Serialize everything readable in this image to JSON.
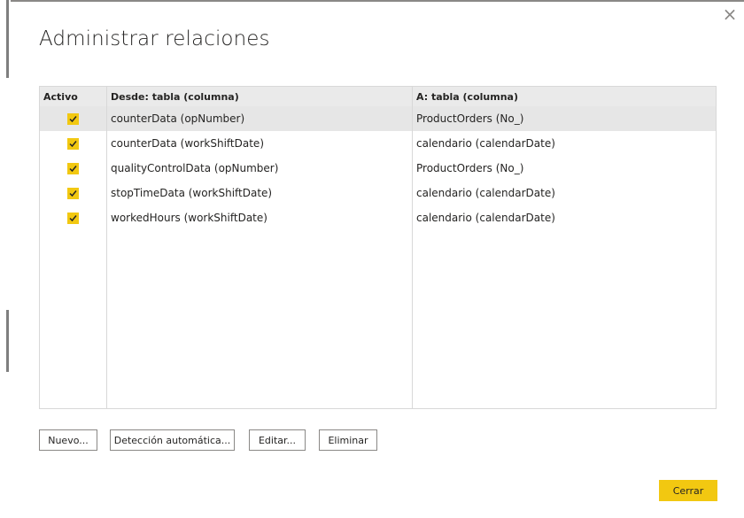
{
  "dialog": {
    "title": "Administrar relaciones",
    "close_glyph": "×"
  },
  "table": {
    "headers": {
      "active": "Activo",
      "from": "Desde: tabla (columna)",
      "to": "A: tabla (columna)"
    },
    "rows": [
      {
        "active": true,
        "from": "counterData (opNumber)",
        "to": "ProductOrders (No_)",
        "selected": true
      },
      {
        "active": true,
        "from": "counterData (workShiftDate)",
        "to": "calendario (calendarDate)",
        "selected": false
      },
      {
        "active": true,
        "from": "qualityControlData (opNumber)",
        "to": "ProductOrders (No_)",
        "selected": false
      },
      {
        "active": true,
        "from": "stopTimeData (workShiftDate)",
        "to": "calendario (calendarDate)",
        "selected": false
      },
      {
        "active": true,
        "from": "workedHours (workShiftDate)",
        "to": "calendario (calendarDate)",
        "selected": false
      }
    ]
  },
  "buttons": {
    "new": "Nuevo...",
    "autodetect": "Detección automática...",
    "edit": "Editar...",
    "delete": "Eliminar",
    "close": "Cerrar"
  },
  "colors": {
    "accent": "#f2c811",
    "selected_row": "#e6e6e6",
    "header_bg": "#eaeaea"
  },
  "icons": {
    "close": "close-icon",
    "checkbox": "checkmark-icon"
  }
}
